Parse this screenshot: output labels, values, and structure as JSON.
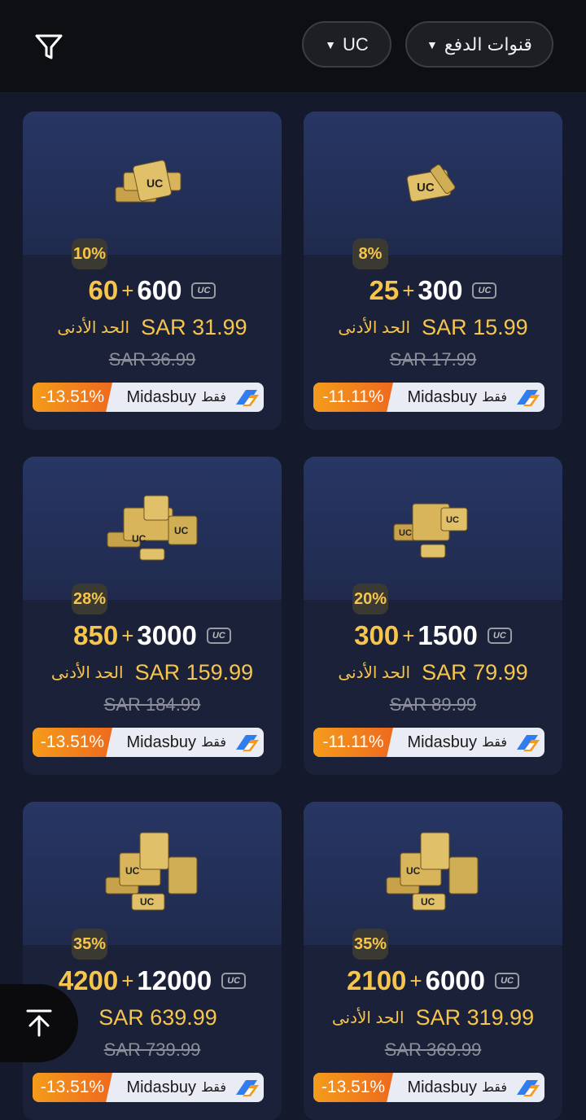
{
  "header": {
    "currency_dropdown": "UC",
    "payment_dropdown": "قنوات الدفع",
    "dropdown_arrow": "▼",
    "filter_icon": "filter-icon"
  },
  "colors": {
    "accent": "#f7c54b",
    "background": "#141a2c",
    "card": "#1a2138",
    "discount": "#f49b1b"
  },
  "cards": [
    {
      "bonus_percent": "10%",
      "bonus_amount": "60",
      "plus": "+",
      "base_amount": "600",
      "price": "SAR 31.99",
      "min_label": "الحد الأدنى",
      "original_price": "SAR 36.99",
      "discount": "-13.51%",
      "brand": "Midasbuy",
      "only_label": "فقط"
    },
    {
      "bonus_percent": "8%",
      "bonus_amount": "25",
      "plus": "+",
      "base_amount": "300",
      "price": "SAR 15.99",
      "min_label": "الحد الأدنى",
      "original_price": "SAR 17.99",
      "discount": "-11.11%",
      "brand": "Midasbuy",
      "only_label": "فقط"
    },
    {
      "bonus_percent": "28%",
      "bonus_amount": "850",
      "plus": "+",
      "base_amount": "3000",
      "price": "SAR 159.99",
      "min_label": "الحد الأدنى",
      "original_price": "SAR 184.99",
      "discount": "-13.51%",
      "brand": "Midasbuy",
      "only_label": "فقط"
    },
    {
      "bonus_percent": "20%",
      "bonus_amount": "300",
      "plus": "+",
      "base_amount": "1500",
      "price": "SAR 79.99",
      "min_label": "الحد الأدنى",
      "original_price": "SAR 89.99",
      "discount": "-11.11%",
      "brand": "Midasbuy",
      "only_label": "فقط"
    },
    {
      "bonus_percent": "35%",
      "bonus_amount": "4200",
      "plus": "+",
      "base_amount": "12000",
      "price": "SAR 639.99",
      "min_label": "",
      "original_price": "SAR 739.99",
      "discount": "-13.51%",
      "brand": "Midasbuy",
      "only_label": "فقط"
    },
    {
      "bonus_percent": "35%",
      "bonus_amount": "2100",
      "plus": "+",
      "base_amount": "6000",
      "price": "SAR 319.99",
      "min_label": "الحد الأدنى",
      "original_price": "SAR 369.99",
      "discount": "-13.51%",
      "brand": "Midasbuy",
      "only_label": "فقط"
    }
  ],
  "uc_icon_text": "UC",
  "scroll_top_icon": "arrow-up-to-top-icon"
}
